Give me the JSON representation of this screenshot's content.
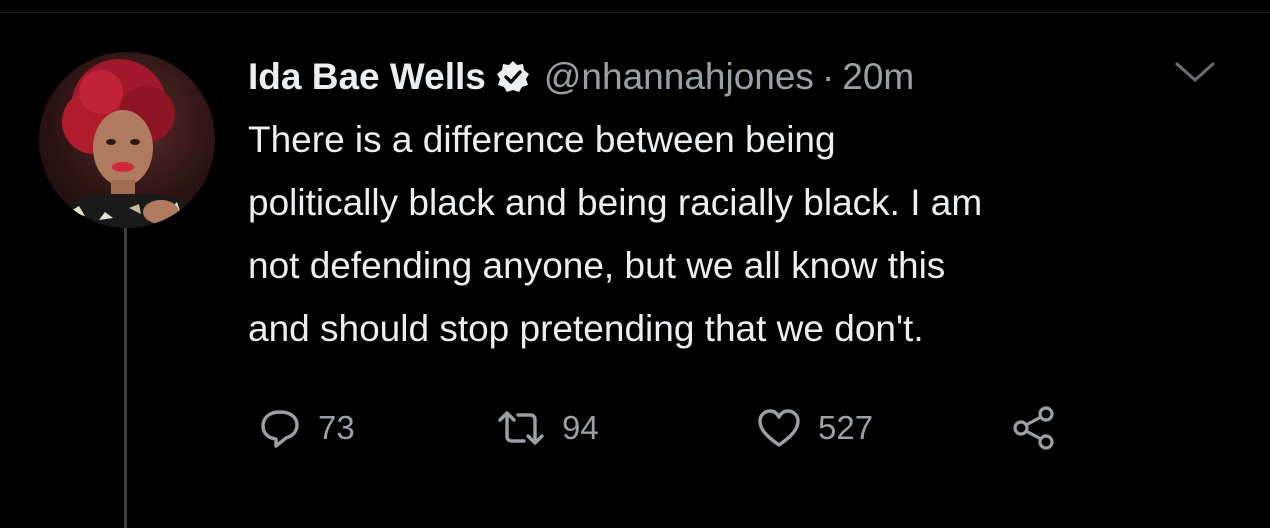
{
  "tweet": {
    "display_name": "Ida Bae Wells",
    "handle": "@nhannahjones",
    "separator": "·",
    "time": "20m",
    "verified": true,
    "body_lines": [
      "There is a difference between being",
      "politically black and being racially black. I am",
      "not defending anyone, but we all know this",
      "and should stop pretending that we don't."
    ],
    "stats": {
      "replies": "73",
      "retweets": "94",
      "likes": "527"
    }
  },
  "icons": {
    "verified": "verified-badge-icon",
    "menu": "chevron-down-icon",
    "reply": "reply-icon",
    "retweet": "retweet-icon",
    "like": "heart-icon",
    "share": "share-icon"
  },
  "colors": {
    "background": "#000000",
    "text": "#eceff1",
    "muted": "#9aa0a6",
    "thread_line": "#3a3d41"
  }
}
